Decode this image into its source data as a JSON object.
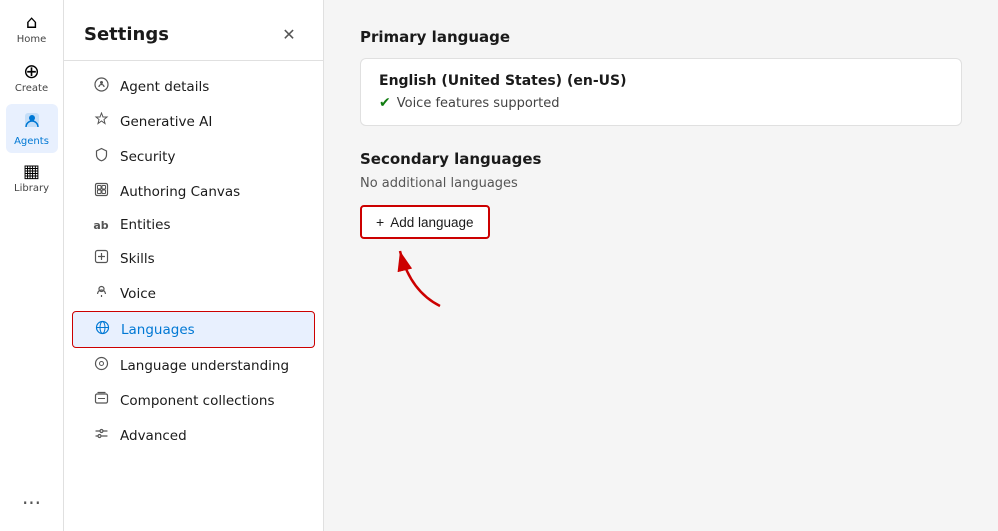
{
  "leftNav": {
    "items": [
      {
        "id": "home",
        "label": "Home",
        "icon": "⌂",
        "active": false
      },
      {
        "id": "create",
        "label": "Create",
        "icon": "+",
        "active": false
      },
      {
        "id": "agents",
        "label": "Agents",
        "icon": "◉",
        "active": true
      },
      {
        "id": "library",
        "label": "Library",
        "icon": "▦",
        "active": false
      }
    ],
    "moreLabel": "..."
  },
  "settings": {
    "title": "Settings",
    "closeLabel": "✕",
    "menuItems": [
      {
        "id": "agent-details",
        "label": "Agent details",
        "icon": "☁",
        "active": false
      },
      {
        "id": "generative-ai",
        "label": "Generative AI",
        "icon": "✦",
        "active": false
      },
      {
        "id": "security",
        "label": "Security",
        "icon": "🔒",
        "active": false
      },
      {
        "id": "authoring-canvas",
        "label": "Authoring Canvas",
        "icon": "⊞",
        "active": false
      },
      {
        "id": "entities",
        "label": "Entities",
        "icon": "ab",
        "active": false
      },
      {
        "id": "skills",
        "label": "Skills",
        "icon": "⊟",
        "active": false
      },
      {
        "id": "voice",
        "label": "Voice",
        "icon": "👤",
        "active": false
      },
      {
        "id": "languages",
        "label": "Languages",
        "icon": "◈",
        "active": true
      },
      {
        "id": "language-understanding",
        "label": "Language understanding",
        "icon": "⊙",
        "active": false
      },
      {
        "id": "component-collections",
        "label": "Component collections",
        "icon": "⊡",
        "active": false
      },
      {
        "id": "advanced",
        "label": "Advanced",
        "icon": "⇄",
        "active": false
      }
    ]
  },
  "main": {
    "primaryLanguage": {
      "sectionTitle": "Primary language",
      "languageName": "English (United States) (en-US)",
      "voiceLabel": "Voice features supported"
    },
    "secondaryLanguages": {
      "sectionTitle": "Secondary languages",
      "noLanguagesText": "No additional languages",
      "addButtonLabel": "Add language",
      "addButtonIcon": "+"
    }
  }
}
